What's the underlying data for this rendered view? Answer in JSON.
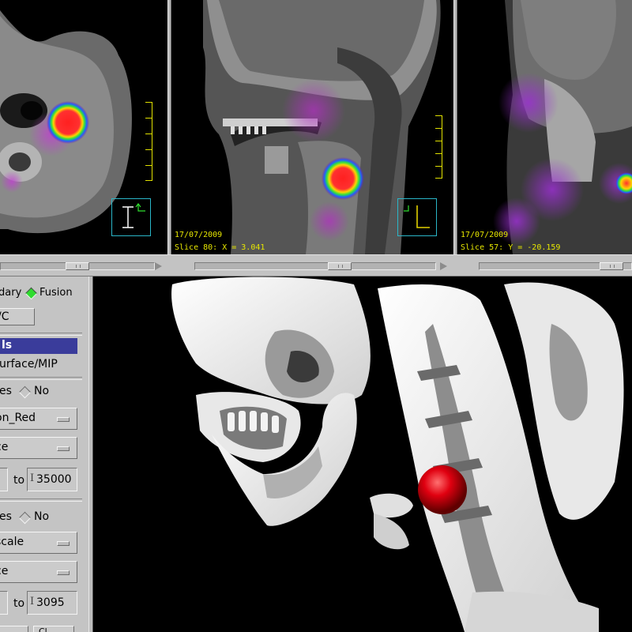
{
  "viewports": {
    "axial": {},
    "sagittal": {
      "date": "17/07/2009",
      "slice_info": "Slice 80: X = 3.041"
    },
    "coronal": {
      "date": "17/07/2009",
      "slice_info": "Slice 57: Y = -20.159"
    }
  },
  "controls": {
    "display_mode": {
      "option_boundary": "dary",
      "option_fusion": "Fusion",
      "selected": "Fusion"
    },
    "vc_button_label": "/C",
    "section_header": "ls",
    "render_mode_label": "urface/MIP",
    "toggle1": {
      "yes_label": "es",
      "no_label": "No"
    },
    "colormap1": "on_Red",
    "mode1": "ce",
    "range1": {
      "to_label": "to",
      "max": "35000"
    },
    "toggle2": {
      "yes_label": "es",
      "no_label": "No"
    },
    "colormap2": "scale",
    "mode2": "ce",
    "range2": {
      "to_label": "to",
      "max": "3095"
    },
    "bottom_button": "Cl"
  },
  "colors": {
    "panel_bg": "#c4c4c4",
    "header_bg": "#3a3c9b",
    "overlay_text": "#e6e600",
    "radio_on": "#2fdc2f",
    "orientation_marker": "#2ab6c8",
    "lesion": "#e0000a"
  },
  "icons": {
    "radio_on": "diamond-radio-on",
    "radio_off": "diamond-radio-off",
    "text_cursor": "ibeam-icon",
    "scroll_arrow": "triangle-right-icon",
    "orientation": "patient-orientation-icon"
  }
}
